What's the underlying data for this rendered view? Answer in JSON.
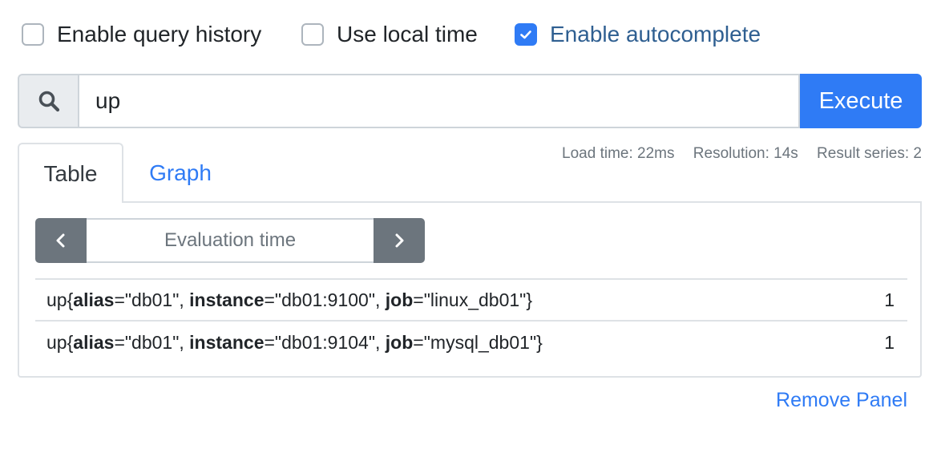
{
  "options": {
    "query_history": {
      "label": "Enable query history",
      "checked": false
    },
    "local_time": {
      "label": "Use local time",
      "checked": false
    },
    "autocomplete": {
      "label": "Enable autocomplete",
      "checked": true
    }
  },
  "query": {
    "value": "up",
    "execute_label": "Execute",
    "icon": "search-icon"
  },
  "tabs": [
    {
      "label": "Table",
      "active": true
    },
    {
      "label": "Graph",
      "active": false
    }
  ],
  "stats": {
    "load_time": "Load time: 22ms",
    "resolution": "Resolution: 14s",
    "result_series": "Result series: 2"
  },
  "evaluation": {
    "placeholder": "Evaluation time",
    "prev_icon": "chevron-left-icon",
    "next_icon": "chevron-right-icon"
  },
  "results": [
    {
      "metric": "up",
      "labels": [
        {
          "key": "alias",
          "value": "db01"
        },
        {
          "key": "instance",
          "value": "db01:9100"
        },
        {
          "key": "job",
          "value": "linux_db01"
        }
      ],
      "value": "1"
    },
    {
      "metric": "up",
      "labels": [
        {
          "key": "alias",
          "value": "db01"
        },
        {
          "key": "instance",
          "value": "db01:9104"
        },
        {
          "key": "job",
          "value": "mysql_db01"
        }
      ],
      "value": "1"
    }
  ],
  "remove_panel_label": "Remove Panel",
  "colors": {
    "accent": "#2f7bf5",
    "nav_button": "#6c757d",
    "border": "#dee2e6"
  }
}
